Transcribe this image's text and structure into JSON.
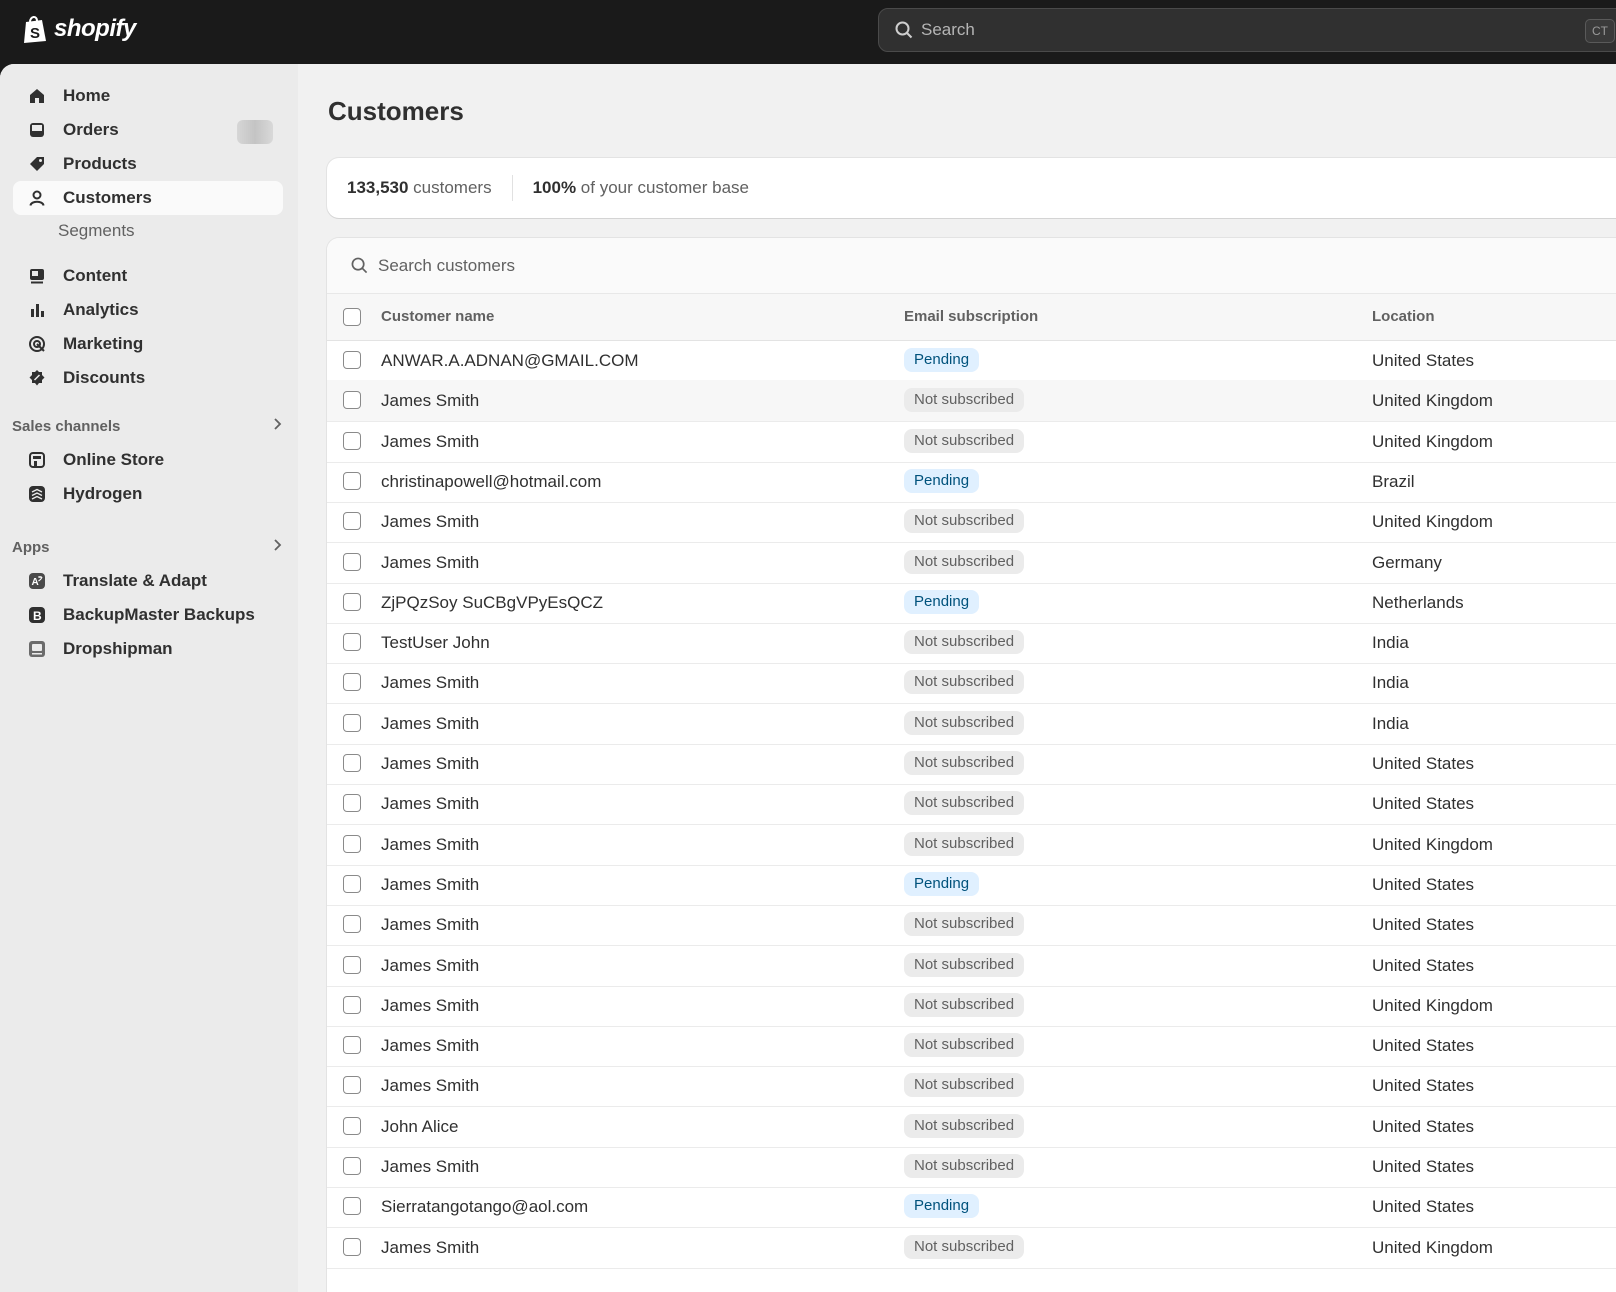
{
  "brand": {
    "name": "shopify"
  },
  "global_search": {
    "placeholder": "Search",
    "shortcut": "CT"
  },
  "sidebar": {
    "items": [
      {
        "label": "Home",
        "icon": "home-icon"
      },
      {
        "label": "Orders",
        "icon": "inbox-icon"
      },
      {
        "label": "Products",
        "icon": "tag-icon"
      },
      {
        "label": "Customers",
        "icon": "person-icon",
        "active": true
      },
      {
        "label": "Segments"
      },
      {
        "label": "Content",
        "icon": "content-icon"
      },
      {
        "label": "Analytics",
        "icon": "bar-chart-icon"
      },
      {
        "label": "Marketing",
        "icon": "target-icon"
      },
      {
        "label": "Discounts",
        "icon": "discount-icon"
      }
    ],
    "sales_channels": {
      "label": "Sales channels",
      "items": [
        {
          "label": "Online Store",
          "icon": "store-icon"
        },
        {
          "label": "Hydrogen",
          "icon": "hydrogen-icon"
        }
      ]
    },
    "apps": {
      "label": "Apps",
      "items": [
        {
          "label": "Translate & Adapt",
          "icon": "translate-icon"
        },
        {
          "label": "BackupMaster Backups",
          "icon": "backupmaster-icon"
        },
        {
          "label": "Dropshipman",
          "icon": "dropshipman-icon"
        }
      ]
    }
  },
  "page": {
    "title": "Customers",
    "stats": {
      "count": "133,530",
      "count_suffix": " customers",
      "share": "100%",
      "share_suffix": " of your customer base"
    },
    "table_search_placeholder": "Search customers",
    "columns": {
      "name": "Customer name",
      "email": "Email subscription",
      "location": "Location"
    }
  },
  "customers": [
    {
      "name": "ANWAR.A.ADNAN@GMAIL.COM",
      "status": "Pending",
      "location": "United States"
    },
    {
      "name": "James Smith",
      "status": "Not subscribed",
      "location": "United Kingdom"
    },
    {
      "name": "James Smith",
      "status": "Not subscribed",
      "location": "United Kingdom"
    },
    {
      "name": "christinapowell@hotmail.com",
      "status": "Pending",
      "location": "Brazil"
    },
    {
      "name": "James Smith",
      "status": "Not subscribed",
      "location": "United Kingdom"
    },
    {
      "name": "James Smith",
      "status": "Not subscribed",
      "location": "Germany"
    },
    {
      "name": "ZjPQzSoy SuCBgVPyEsQCZ",
      "status": "Pending",
      "location": "Netherlands"
    },
    {
      "name": "TestUser John",
      "status": "Not subscribed",
      "location": "India"
    },
    {
      "name": "James Smith",
      "status": "Not subscribed",
      "location": "India"
    },
    {
      "name": "James Smith",
      "status": "Not subscribed",
      "location": "India"
    },
    {
      "name": "James Smith",
      "status": "Not subscribed",
      "location": "United States"
    },
    {
      "name": "James Smith",
      "status": "Not subscribed",
      "location": "United States"
    },
    {
      "name": "James Smith",
      "status": "Not subscribed",
      "location": "United Kingdom"
    },
    {
      "name": "James Smith",
      "status": "Pending",
      "location": "United States"
    },
    {
      "name": "James Smith",
      "status": "Not subscribed",
      "location": "United States"
    },
    {
      "name": "James Smith",
      "status": "Not subscribed",
      "location": "United States"
    },
    {
      "name": "James Smith",
      "status": "Not subscribed",
      "location": "United Kingdom"
    },
    {
      "name": "James Smith",
      "status": "Not subscribed",
      "location": "United States"
    },
    {
      "name": "James Smith",
      "status": "Not subscribed",
      "location": "United States"
    },
    {
      "name": "John Alice",
      "status": "Not subscribed",
      "location": "United States"
    },
    {
      "name": "James Smith",
      "status": "Not subscribed",
      "location": "United States"
    },
    {
      "name": "Sierratangotango@aol.com",
      "status": "Pending",
      "location": "United States"
    },
    {
      "name": "James Smith",
      "status": "Not subscribed",
      "location": "United Kingdom"
    }
  ]
}
